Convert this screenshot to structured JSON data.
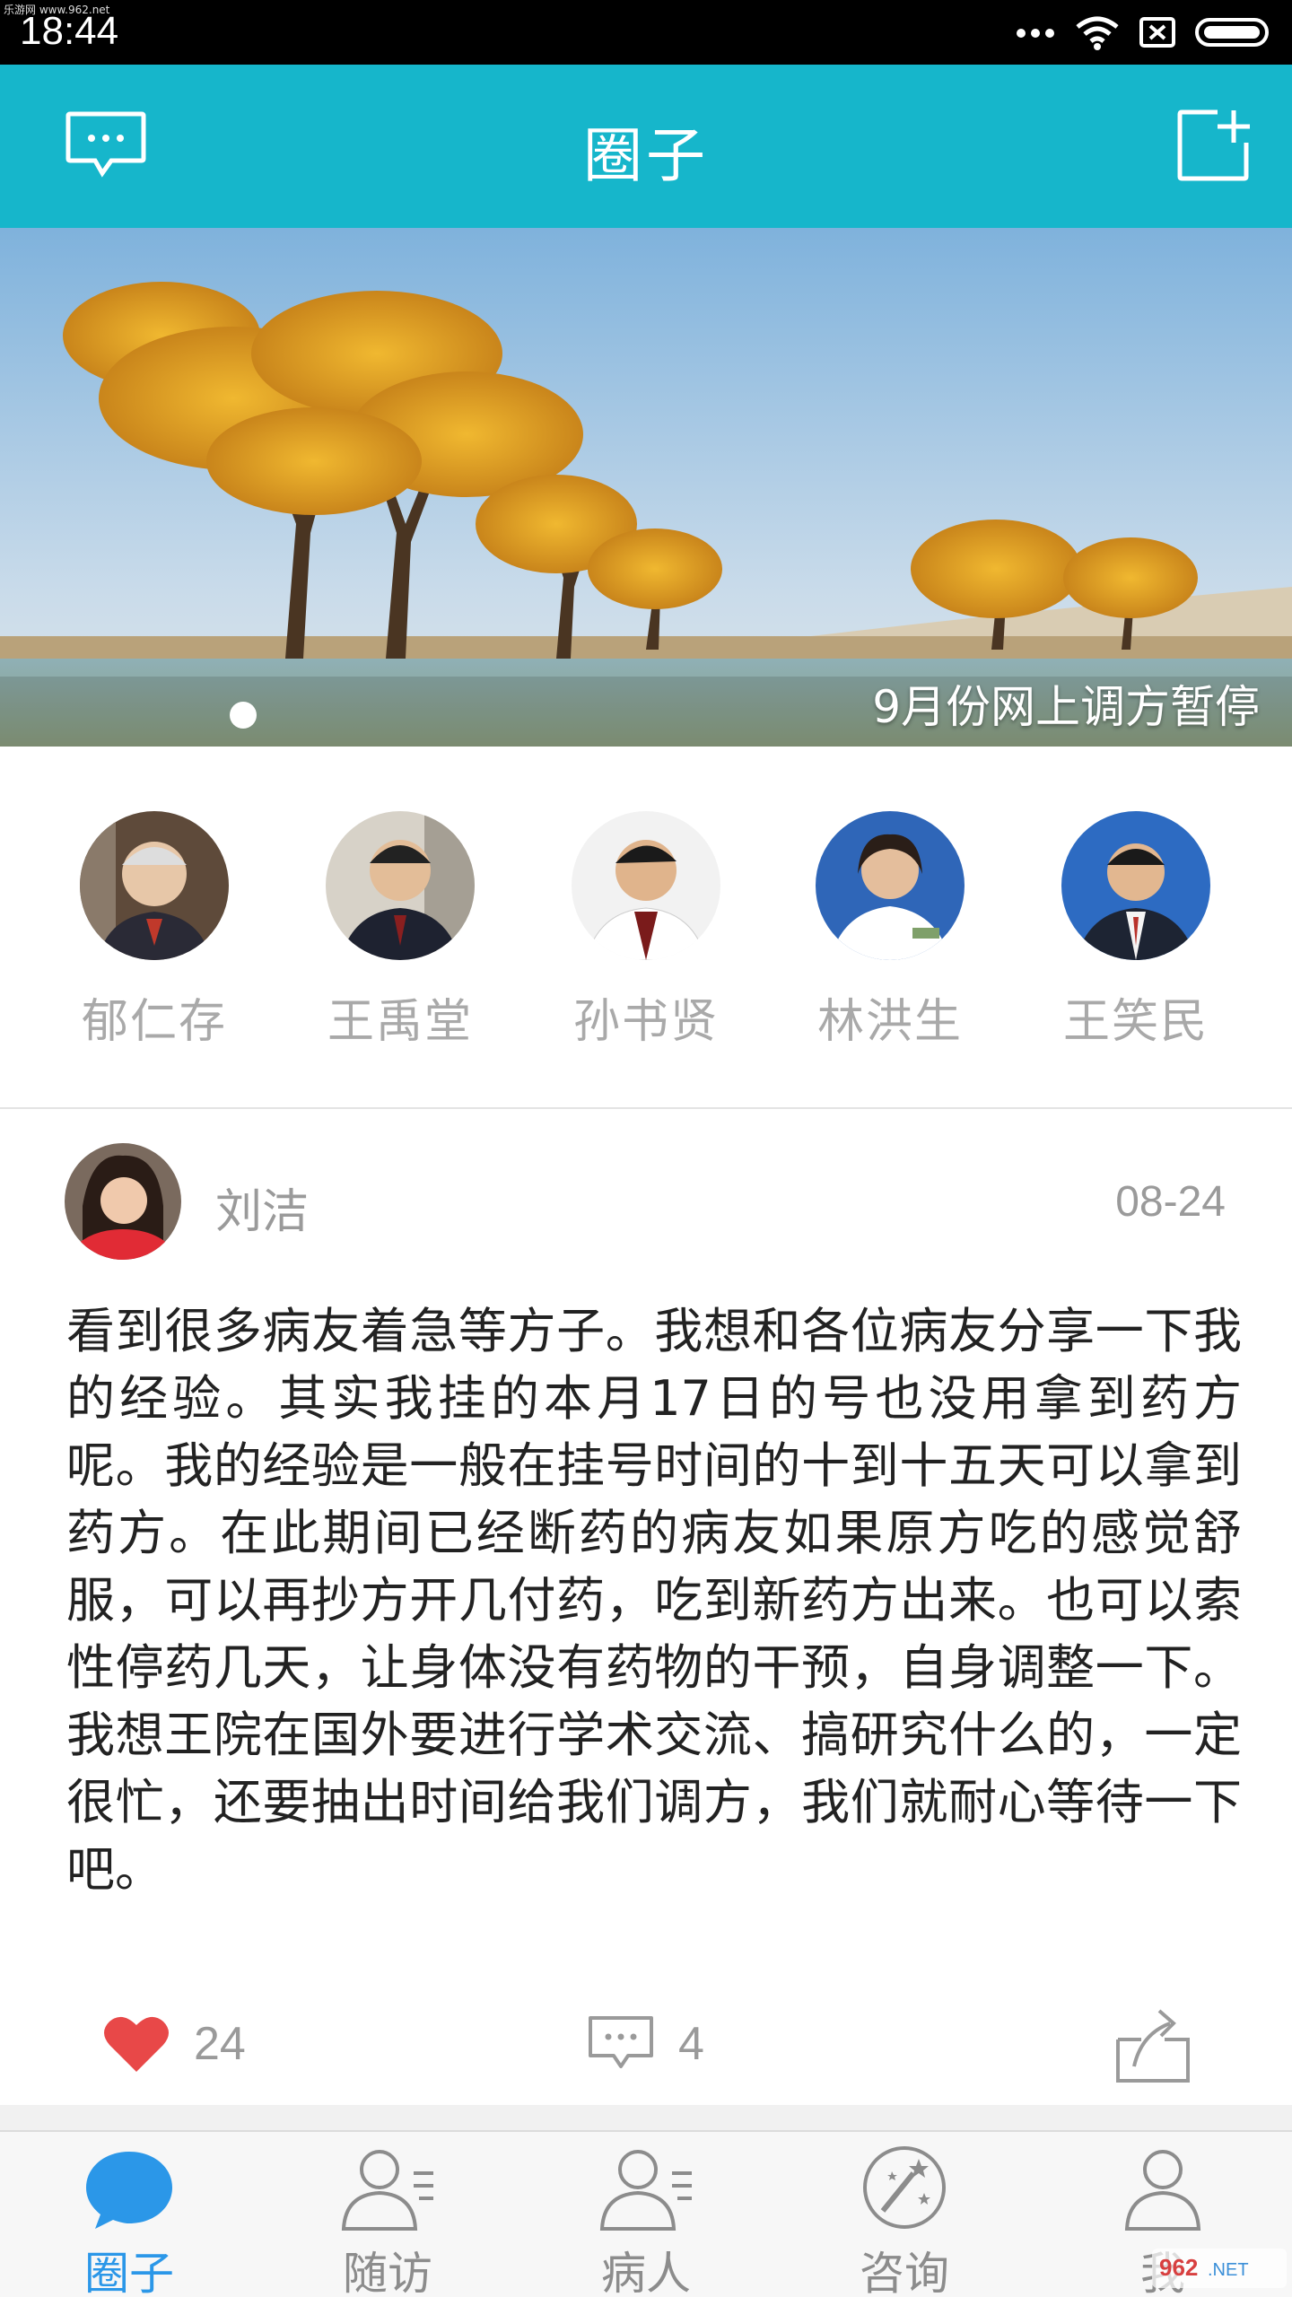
{
  "status_bar": {
    "time": "18:44",
    "watermark": "乐游网 www.962.net"
  },
  "app_bar": {
    "title": "圈子",
    "left_icon": "message-icon",
    "right_icon": "new-post-icon"
  },
  "banner": {
    "caption": "9月份网上调方暂停",
    "active_dot": 1
  },
  "experts": [
    {
      "name": "郁仁存"
    },
    {
      "name": "王禹堂"
    },
    {
      "name": "孙书贤"
    },
    {
      "name": "林洪生"
    },
    {
      "name": "王笑民"
    }
  ],
  "post": {
    "author": "刘洁",
    "date": "08-24",
    "content": "看到很多病友着急等方子。我想和各位病友分享一下我的经验。其实我挂的本月17日的号也没用拿到药方呢。我的经验是一般在挂号时间的十到十五天可以拿到药方。在此期间已经断药的病友如果原方吃的感觉舒服，可以再抄方开几付药，吃到新药方出来。也可以索性停药几天，让身体没有药物的干预，自身调整一下。我想王院在国外要进行学术交流、搞研究什么的，一定很忙，还要抽出时间给我们调方，我们就耐心等待一下吧。",
    "likes": "24",
    "comments": "4"
  },
  "bottom_nav": [
    {
      "label": "圈子",
      "icon": "chat-bubble-icon",
      "active": true
    },
    {
      "label": "随访",
      "icon": "follow-up-icon",
      "active": false
    },
    {
      "label": "病人",
      "icon": "patient-icon",
      "active": false
    },
    {
      "label": "咨询",
      "icon": "consult-icon",
      "active": false
    },
    {
      "label": "我",
      "icon": "profile-icon",
      "active": false
    }
  ],
  "colors": {
    "accent": "#16b6cb",
    "nav_active": "#2b97e8",
    "like": "#e84848"
  },
  "brand_mark": "962.NET 乐游网"
}
